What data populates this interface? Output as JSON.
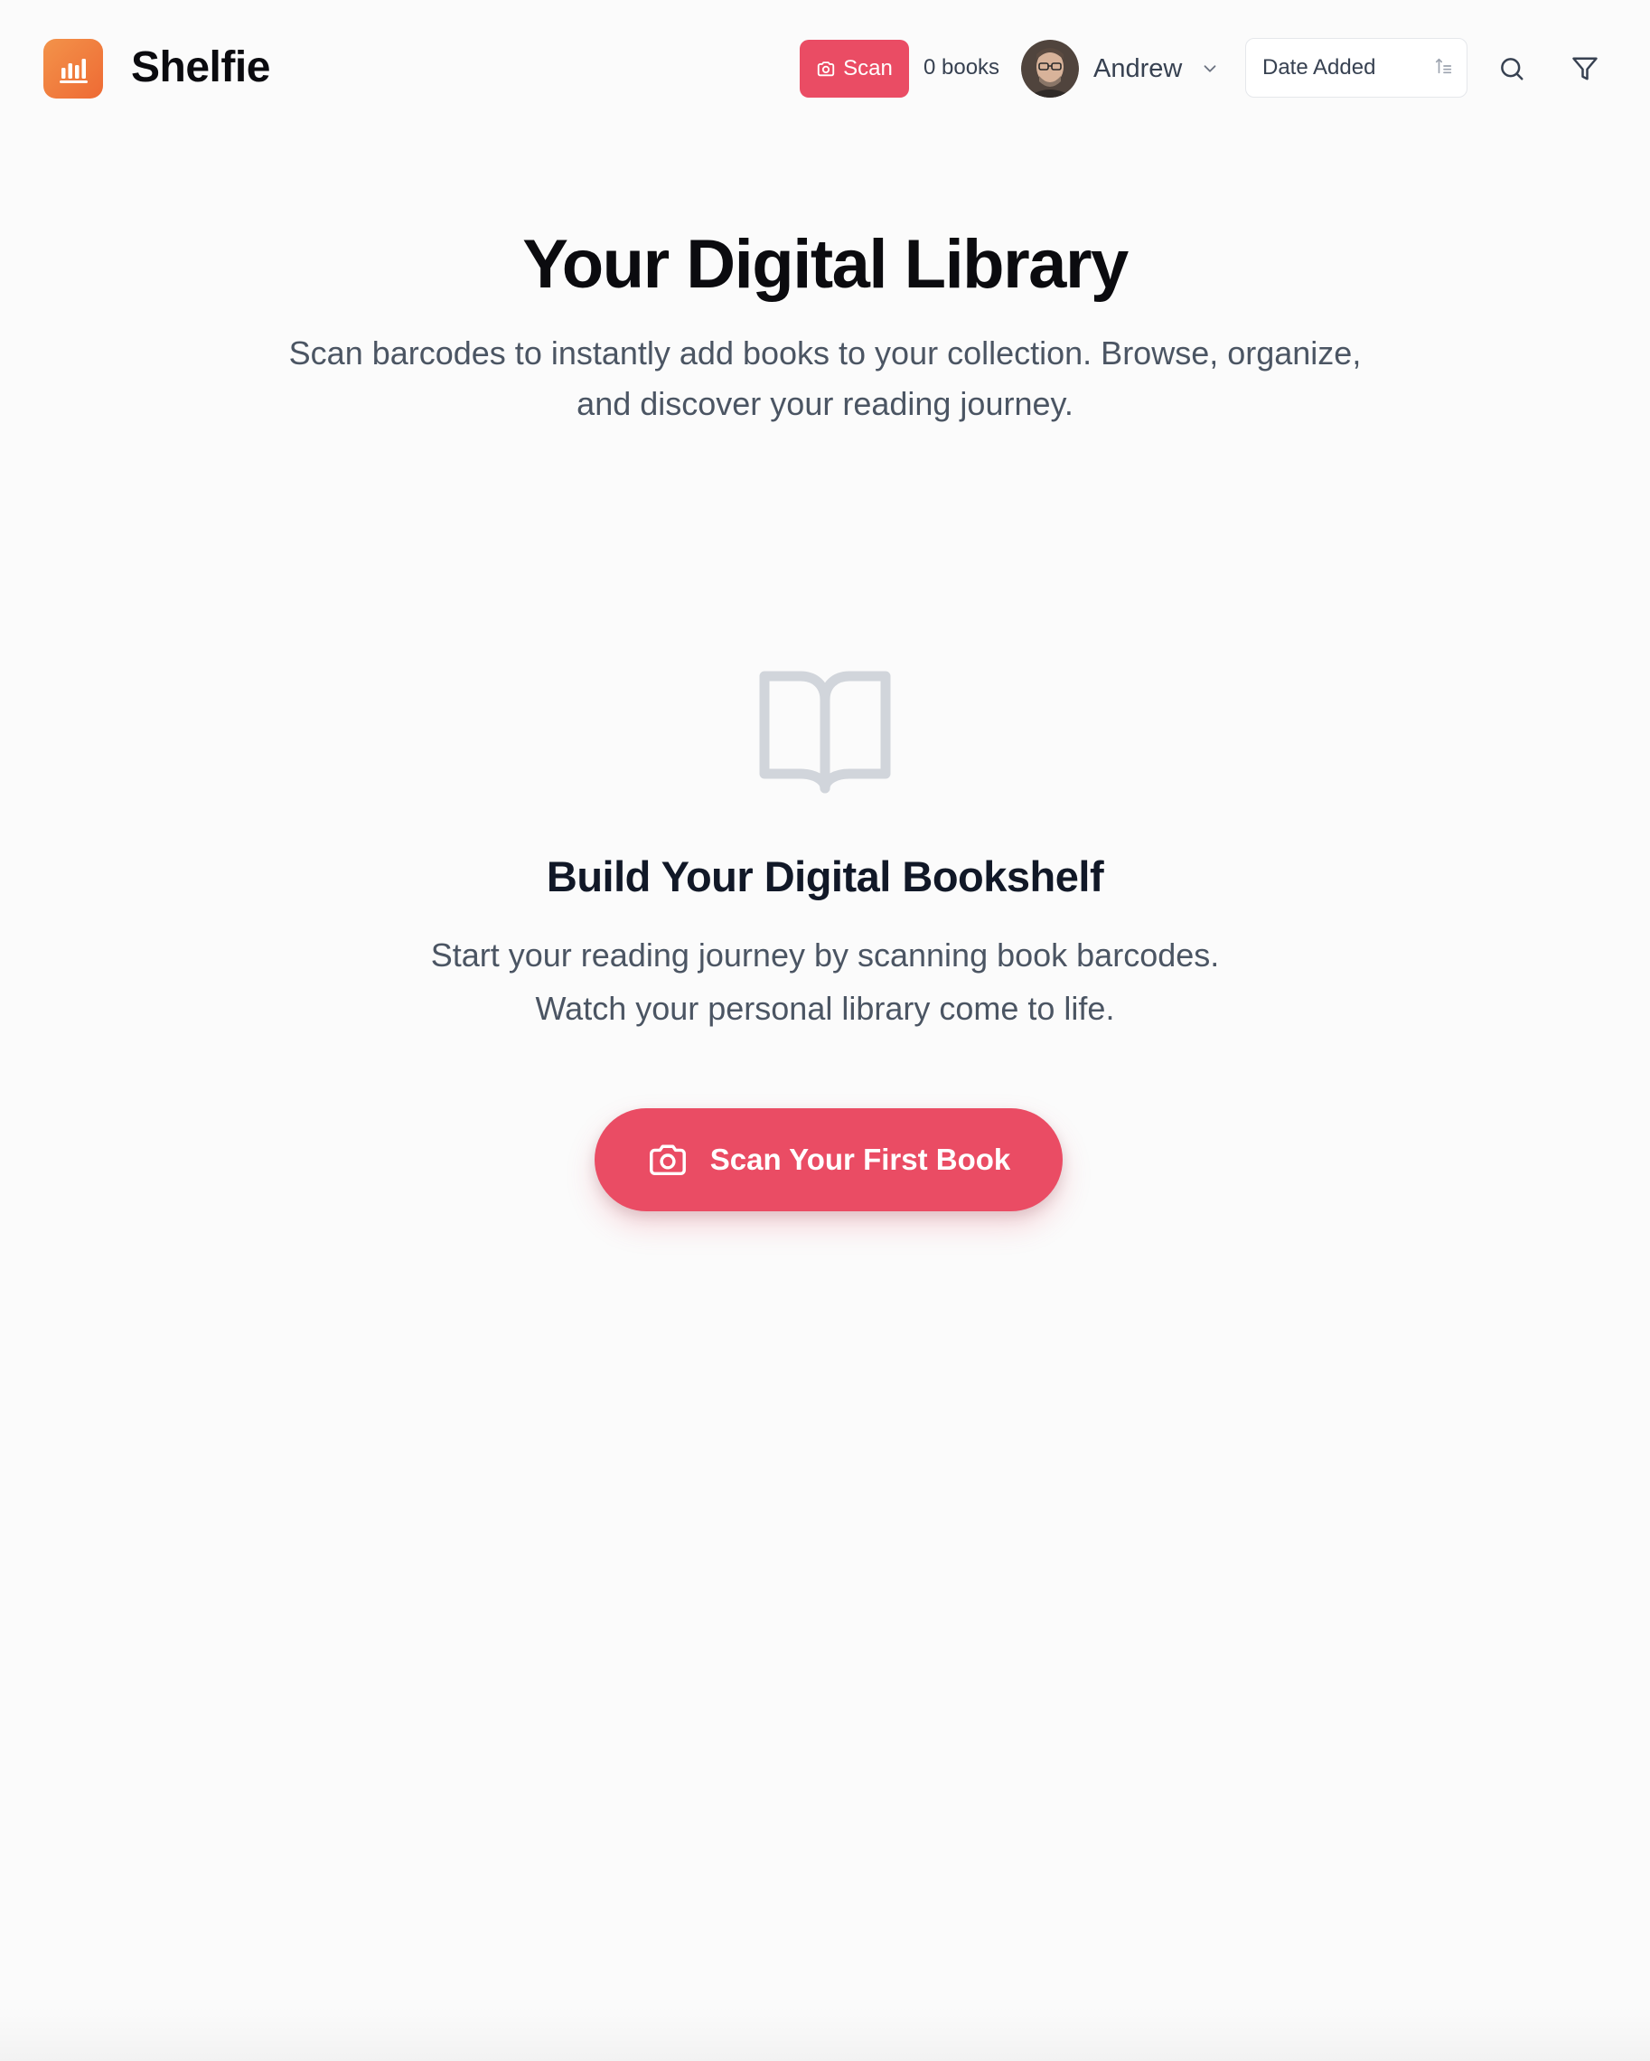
{
  "colors": {
    "accent": "#ea4c64",
    "logo_gradient_start": "#f3934a",
    "logo_gradient_end": "#ee6a34",
    "background": "#fbfbfb",
    "muted_text": "#4b5563",
    "icon_gray": "#d1d5db"
  },
  "header": {
    "app_name": "Shelfie",
    "logo_icon": "bar-chart-icon",
    "scan_button": {
      "label": "Scan",
      "icon": "camera-icon"
    },
    "book_count": "0 books",
    "user": {
      "name": "Andrew",
      "avatar": "user-avatar-photo",
      "menu_icon": "chevron-down-icon"
    },
    "sort": {
      "selected": "Date Added",
      "direction_icon": "sort-ascending-icon"
    },
    "search_icon": "search-icon",
    "filter_icon": "filter-icon"
  },
  "hero": {
    "title": "Your Digital Library",
    "subtitle_line1": "Scan barcodes to instantly add books to your collection. Browse, organize,",
    "subtitle_line2": "and discover your reading journey."
  },
  "empty_state": {
    "icon": "open-book-icon",
    "title": "Build Your Digital Bookshelf",
    "text_line1": "Start your reading journey by scanning book barcodes.",
    "text_line2": "Watch your personal library come to life.",
    "cta": {
      "label": "Scan Your First Book",
      "icon": "camera-icon"
    }
  }
}
